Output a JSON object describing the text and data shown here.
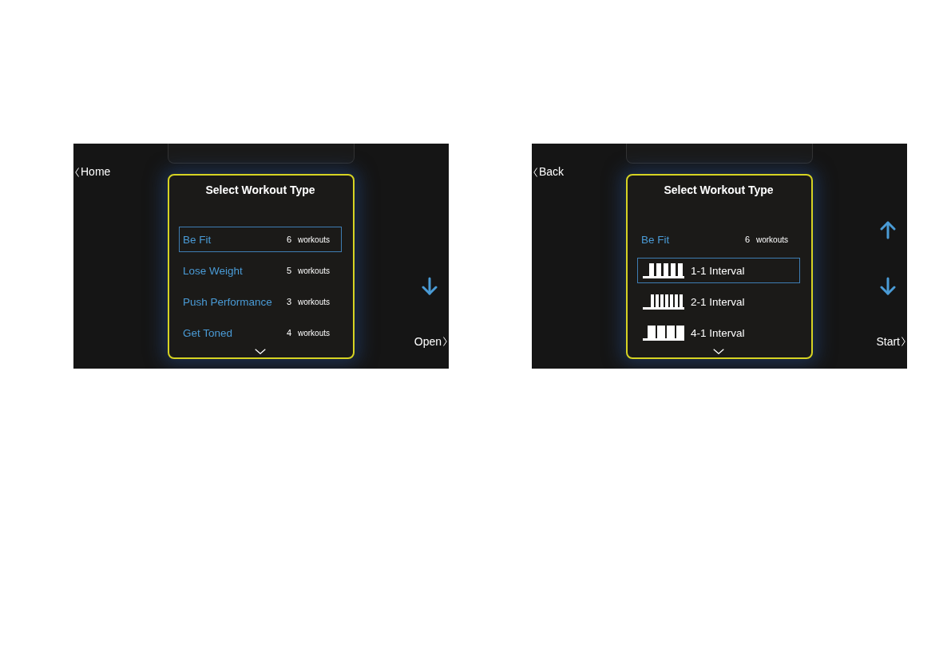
{
  "screens": [
    {
      "back_button": {
        "label": "Home"
      },
      "panel": {
        "title": "Select Workout Type",
        "items": [
          {
            "kind": "category",
            "name": "Be Fit",
            "count": "6",
            "unit": "workouts",
            "selected": true
          },
          {
            "kind": "category",
            "name": "Lose Weight",
            "count": "5",
            "unit": "workouts",
            "selected": false
          },
          {
            "kind": "category",
            "name": "Push Performance",
            "count": "3",
            "unit": "workouts",
            "selected": false
          },
          {
            "kind": "category",
            "name": "Get Toned",
            "count": "4",
            "unit": "workouts",
            "selected": false
          }
        ]
      },
      "scroll_buttons": [
        {
          "kind": "down"
        }
      ],
      "action_button": {
        "label": "Open"
      }
    },
    {
      "back_button": {
        "label": "Back"
      },
      "panel": {
        "title": "Select Workout Type",
        "items": [
          {
            "kind": "category",
            "name": "Be Fit",
            "count": "6",
            "unit": "workouts",
            "selected": false
          },
          {
            "kind": "even",
            "name": "1-1 Interval",
            "selected": true
          },
          {
            "kind": "dense",
            "name": "2-1 Interval",
            "selected": false
          },
          {
            "kind": "wide",
            "name": "4-1 Interval",
            "selected": false
          }
        ]
      },
      "scroll_buttons": [
        {
          "kind": "up"
        },
        {
          "kind": "down"
        }
      ],
      "action_button": {
        "label": "Start"
      }
    }
  ]
}
